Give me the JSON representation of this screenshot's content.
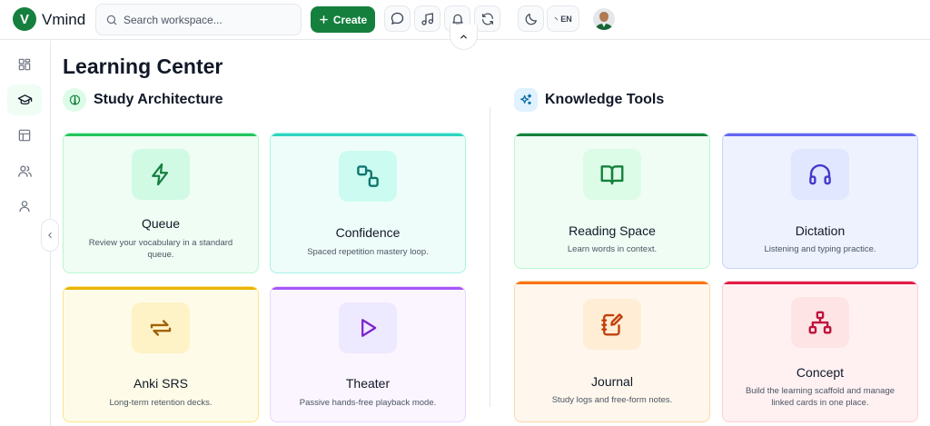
{
  "app": {
    "logo_letter": "V",
    "name": "Vmind"
  },
  "search": {
    "placeholder": "Search workspace..."
  },
  "toolbar": {
    "create_label": "Create",
    "lang_label": "EN"
  },
  "page": {
    "title": "Learning Center"
  },
  "sections": {
    "study": {
      "title": "Study Architecture"
    },
    "knowledge": {
      "title": "Knowledge Tools"
    }
  },
  "cards": {
    "queue": {
      "title": "Queue",
      "desc": "Review your vocabulary in a standard queue."
    },
    "confidence": {
      "title": "Confidence",
      "desc": "Spaced repetition mastery loop."
    },
    "anki": {
      "title": "Anki SRS",
      "desc": "Long-term retention decks."
    },
    "theater": {
      "title": "Theater",
      "desc": "Passive hands-free playback mode."
    },
    "reading": {
      "title": "Reading Space",
      "desc": "Learn words in context."
    },
    "dictation": {
      "title": "Dictation",
      "desc": "Listening and typing practice."
    },
    "journal": {
      "title": "Journal",
      "desc": "Study logs and free-form notes."
    },
    "concept": {
      "title": "Concept",
      "desc": "Build the learning scaffold and manage linked cards in one place."
    }
  },
  "icons": {
    "sidebar": [
      "dashboard-icon",
      "graduation-cap-icon",
      "table-icon",
      "users-icon",
      "user-icon"
    ],
    "topbar": [
      "search-icon",
      "plus-icon",
      "chat-icon",
      "music-icon",
      "bell-icon",
      "refresh-icon",
      "moon-icon",
      "translate-icon",
      "chevron-up-icon"
    ]
  },
  "colors": {
    "brand": "#15803d",
    "queue": "#16a34a",
    "confidence": "#14b8a6",
    "anki": "#eab308",
    "theater": "#a855f7",
    "reading": "#15803d",
    "dictation": "#6366f1",
    "journal": "#f97316",
    "concept": "#e11d48"
  }
}
